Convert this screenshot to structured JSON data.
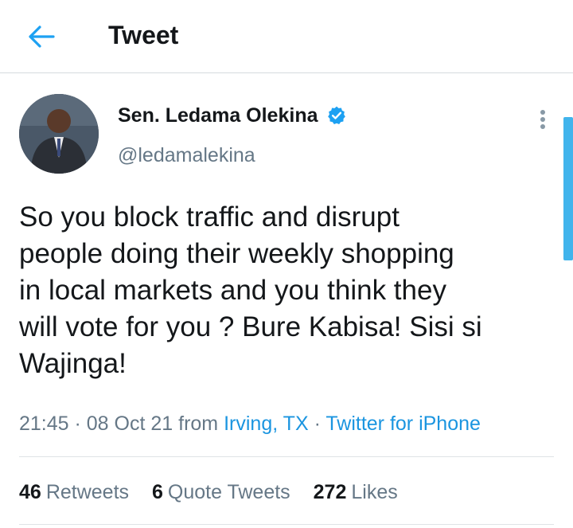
{
  "header": {
    "title": "Tweet",
    "back_icon": "arrow-left-icon",
    "accent": "#1da1f2"
  },
  "author": {
    "display_name": "Sen. Ledama Olekina",
    "handle": "@ledamalekina",
    "verified": true,
    "verified_icon": "verified-badge-icon"
  },
  "tweet": {
    "text": "So you block traffic and disrupt\npeople doing their weekly shopping\nin local markets and you think they\nwill vote for you ? Bure Kabisa! Sisi si\nWajinga!",
    "time": "21:45",
    "sep1": " · ",
    "date": "08 Oct 21",
    "from": " from ",
    "location": "Irving, TX",
    "sep2": " · ",
    "source": "Twitter for iPhone"
  },
  "stats": {
    "retweets_count": "46",
    "retweets_label": "Retweets",
    "quotes_count": "6",
    "quotes_label": "Quote Tweets",
    "likes_count": "272",
    "likes_label": "Likes"
  },
  "colors": {
    "link": "#1b95e0",
    "muted": "#657786",
    "text": "#14171a",
    "scrollbar": "#41b4ec"
  }
}
